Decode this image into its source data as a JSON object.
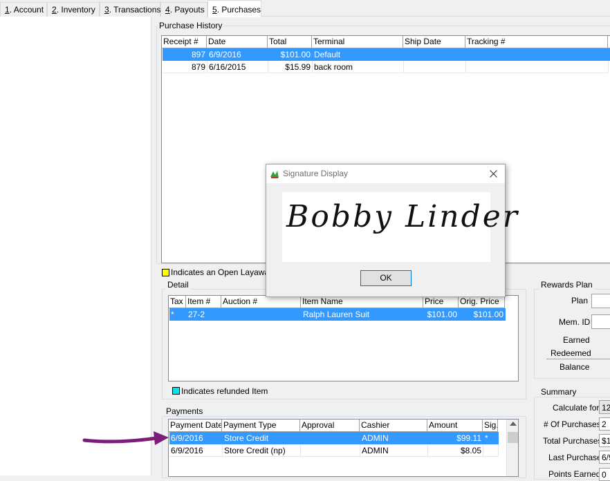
{
  "tabs": [
    {
      "key": "1",
      "label": ". Account"
    },
    {
      "key": "2",
      "label": ". Inventory"
    },
    {
      "key": "3",
      "label": ". Transactions"
    },
    {
      "key": "4",
      "label": ". Payouts"
    },
    {
      "key": "5",
      "label": ". Purchases"
    }
  ],
  "purchase_history": {
    "title": "Purchase History",
    "columns": [
      "Receipt #",
      "Date",
      "Total",
      "Terminal",
      "Ship Date",
      "Tracking #",
      ""
    ],
    "rows": [
      {
        "receipt": "897",
        "date": "6/9/2016",
        "total": "$101.00",
        "terminal": "Default",
        "ship": "",
        "tracking": ""
      },
      {
        "receipt": "879",
        "date": "6/16/2015",
        "total": "$15.99",
        "terminal": "back room",
        "ship": "",
        "tracking": ""
      }
    ]
  },
  "layaway_legend": "Indicates an Open Layaway",
  "detail": {
    "title": "Detail",
    "columns": [
      "Tax",
      "Item #",
      "Auction #",
      "Item Name",
      "Price",
      "Orig. Price"
    ],
    "rows": [
      {
        "tax": "*",
        "item": "27-2",
        "auction": "",
        "name": "Ralph Lauren Suit",
        "price": "$101.00",
        "orig": "$101.00"
      }
    ],
    "refund_legend": "Indicates refunded Item"
  },
  "payments": {
    "title": "Payments",
    "columns": [
      "Payment Date",
      "Payment Type",
      "Approval",
      "Cashier",
      "Amount",
      "Sig."
    ],
    "rows": [
      {
        "date": "6/9/2016",
        "type": "Store Credit",
        "approval": "",
        "cashier": "ADMIN",
        "amount": "$99.11",
        "sig": "*"
      },
      {
        "date": "6/9/2016",
        "type": "Store Credit (np)",
        "approval": "",
        "cashier": "ADMIN",
        "amount": "$8.05",
        "sig": ""
      }
    ]
  },
  "rewards": {
    "title": "Rewards Plan",
    "plan_label": "Plan",
    "mem_label": "Mem. ID",
    "earned_label": "Earned",
    "redeemed_label": "Redeemed",
    "balance_label": "Balance"
  },
  "summary": {
    "title": "Summary",
    "calculate_label": "Calculate for",
    "calculate_value": "12",
    "num_purchases_label": "# Of Purchases",
    "num_purchases_value": "2",
    "total_purchases_label": "Total Purchases",
    "total_purchases_value": "$1",
    "last_purchase_label": "Last Purchase",
    "last_purchase_value": "6/9",
    "points_earned_label": "Points Earned",
    "points_earned_value": "0"
  },
  "dialog": {
    "title": "Signature Display",
    "ok_label": "OK",
    "signature_text": "Bobby Linder"
  },
  "colors": {
    "selection": "#3399ff",
    "layaway": "#ffff00",
    "refund": "#00e5ee",
    "arrow": "#7b1e7a"
  }
}
